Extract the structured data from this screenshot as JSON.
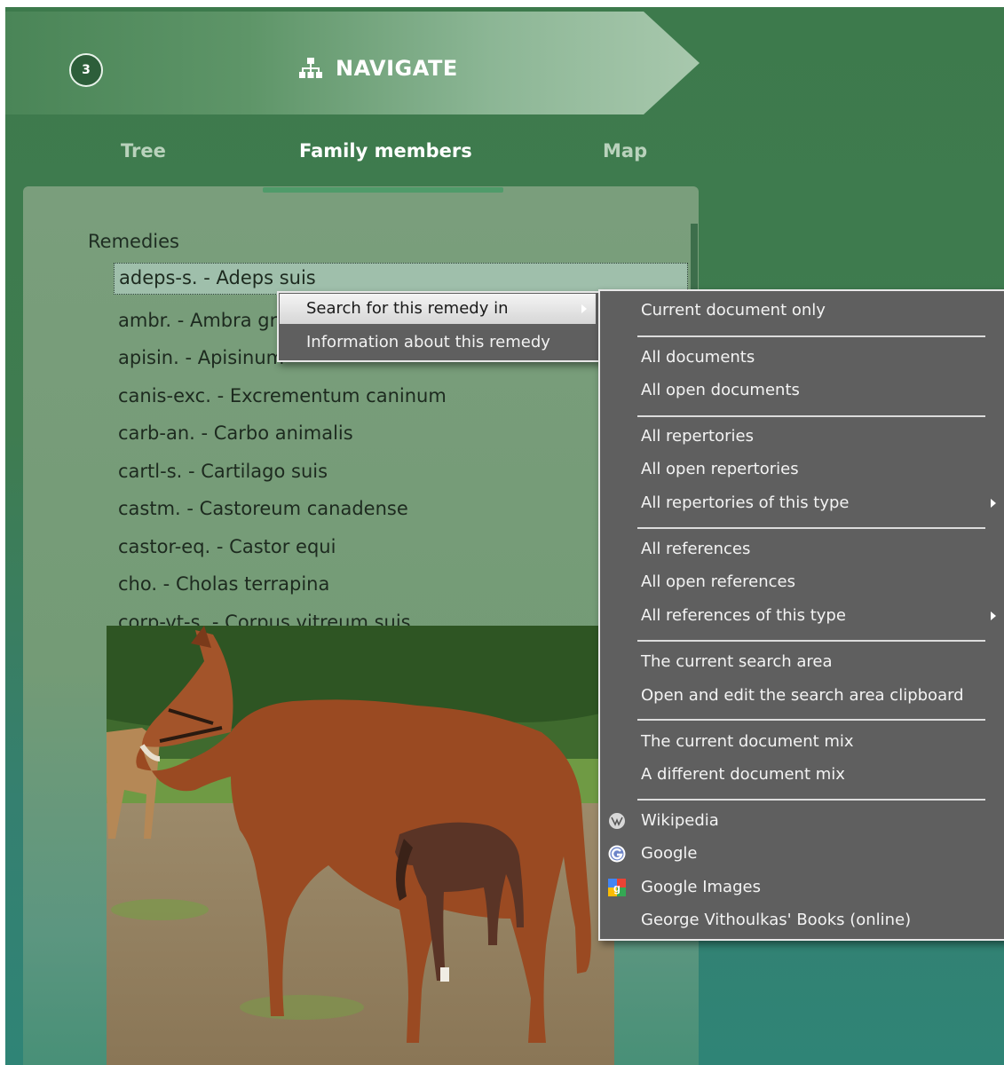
{
  "header": {
    "step": "3",
    "title": "NAVIGATE",
    "icon": "sitemap-icon"
  },
  "tabs": [
    {
      "label": "Tree",
      "active": false
    },
    {
      "label": "Family members",
      "active": true
    },
    {
      "label": "Map",
      "active": false
    }
  ],
  "panel": {
    "section_title": "Remedies",
    "remedies": [
      "adeps-s. - Adeps suis",
      "ambr. - Ambra grisea",
      "apisin. - Apisinum",
      "canis-exc. - Excrementum caninum",
      "carb-an. - Carbo animalis",
      "cartl-s. - Cartilago suis",
      "castm. - Castoreum canadense",
      "castor-eq. - Castor equi",
      "cho. - Cholas terrapina",
      "corp-vt-s. - Corpus vitreum suis"
    ],
    "selected_index": 0
  },
  "context_menu": {
    "items": [
      "Search for this remedy in",
      "Information about this remedy"
    ],
    "highlighted_index": 0
  },
  "submenu": {
    "groups": [
      [
        "Current document only"
      ],
      [
        "All documents",
        "All open documents"
      ],
      [
        "All repertories",
        "All open repertories",
        "All repertories of this type"
      ],
      [
        "All references",
        "All open references",
        "All references of this type"
      ],
      [
        "The current search area",
        "Open and edit the search area clipboard"
      ],
      [
        "The current document mix",
        "A different document mix"
      ],
      [
        "Wikipedia",
        "Google",
        "Google Images",
        "George Vithoulkas' Books (online)"
      ]
    ],
    "icons": {
      "Wikipedia": "wikipedia-icon",
      "Google": "google-icon",
      "Google Images": "google-images-icon"
    }
  },
  "colors": {
    "background": "#3d7a4c",
    "panel": "#7a9e7c",
    "menu": "#5f5f5f",
    "active_tab_underline": "#4f9b6a"
  }
}
